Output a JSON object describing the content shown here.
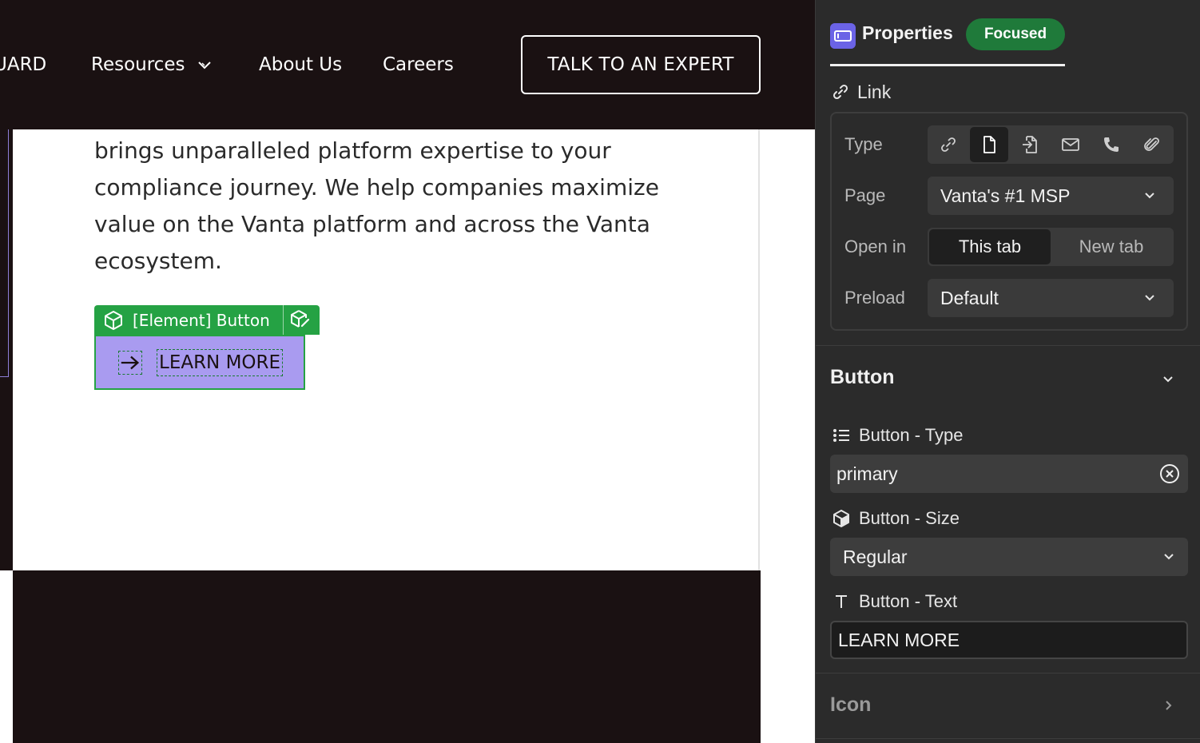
{
  "canvas": {
    "nav": {
      "partial_item": "UARD",
      "resources": "Resources",
      "about": "About Us",
      "careers": "Careers",
      "cta": "TALK TO AN EXPERT"
    },
    "paragraph": "brings unparalleled platform expertise to your compliance journey. We help companies maximize value on the Vanta platform and across the Vanta ecosystem.",
    "element_tag": "[Element] Button",
    "button_label": "LEARN MORE"
  },
  "panel": {
    "title": "Properties",
    "badge": "Focused",
    "link": {
      "heading": "Link",
      "type_label": "Type",
      "type_options": [
        "link-icon",
        "page-icon",
        "section-icon",
        "email-icon",
        "phone-icon",
        "attachment-icon"
      ],
      "type_selected": "page-icon",
      "page_label": "Page",
      "page_value": "Vanta's #1 MSP",
      "open_label": "Open in",
      "open_options": [
        "This tab",
        "New tab"
      ],
      "open_selected": "This tab",
      "preload_label": "Preload",
      "preload_value": "Default"
    },
    "button_section": {
      "title": "Button",
      "type_label": "Button - Type",
      "type_value": "primary",
      "size_label": "Button - Size",
      "size_value": "Regular",
      "text_label": "Button - Text",
      "text_value": "LEARN MORE"
    },
    "icon_section": {
      "title": "Icon"
    }
  },
  "colors": {
    "nav_bg": "#1a1112",
    "selection_green": "#25a244",
    "button_purple": "#a99bf0",
    "panel_bg": "#2b2b2b",
    "badge_green": "#1f7a3a",
    "accent_indigo": "#6b63e6"
  }
}
